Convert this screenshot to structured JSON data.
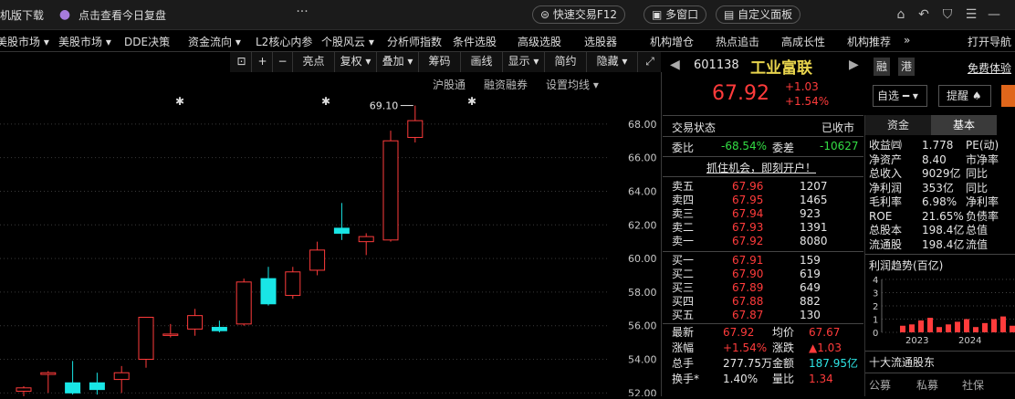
{
  "titlebar": {
    "download": "机版下载",
    "review": "点击查看今日复盘",
    "quick_trade": "快速交易F12",
    "multi_window": "多窗口",
    "custom_panel": "自定义面板"
  },
  "menu": [
    "美股市场 ▾",
    "美股市场 ▾",
    "DDE决策",
    "资金流向 ▾",
    "L2核心内参",
    "个股风云 ▾",
    "分析师指数",
    "条件选股",
    "高级选股",
    "选股器",
    "机构增仓",
    "热点追击",
    "高成长性",
    "机构推荐",
    "»",
    "打开导航"
  ],
  "chart_tools": [
    "亮点",
    "复权 ▾",
    "叠加 ▾",
    "筹码",
    "画线",
    "显示 ▾",
    "简约",
    "隐藏 ▾"
  ],
  "chart_sublinks": [
    "沪股通",
    "融资融券",
    "设置均线 ▾"
  ],
  "chart_data": {
    "type": "candlestick",
    "y_ticks": [
      "68.00",
      "66.00",
      "64.00",
      "62.00",
      "60.00",
      "58.00",
      "56.00",
      "54.00",
      "52.00"
    ],
    "ylim": [
      51.8,
      70.0
    ],
    "max_label": "69.10",
    "candles": [
      {
        "o": 52.1,
        "h": 52.4,
        "l": 51.8,
        "c": 52.3
      },
      {
        "o": 53.1,
        "h": 53.3,
        "l": 52.0,
        "c": 53.2
      },
      {
        "o": 52.6,
        "h": 53.9,
        "l": 51.9,
        "c": 52.0
      },
      {
        "o": 52.6,
        "h": 53.2,
        "l": 51.9,
        "c": 52.2
      },
      {
        "o": 52.8,
        "h": 53.6,
        "l": 52.0,
        "c": 53.2
      },
      {
        "o": 54.0,
        "h": 56.5,
        "l": 53.5,
        "c": 56.5
      },
      {
        "o": 55.5,
        "h": 56.1,
        "l": 55.3,
        "c": 55.5
      },
      {
        "o": 55.8,
        "h": 57.0,
        "l": 55.4,
        "c": 56.6
      },
      {
        "o": 55.9,
        "h": 56.3,
        "l": 55.6,
        "c": 55.7
      },
      {
        "o": 56.1,
        "h": 58.8,
        "l": 56.0,
        "c": 58.6
      },
      {
        "o": 58.8,
        "h": 59.5,
        "l": 57.2,
        "c": 57.3
      },
      {
        "o": 57.8,
        "h": 59.5,
        "l": 57.6,
        "c": 59.2
      },
      {
        "o": 59.3,
        "h": 61.0,
        "l": 59.0,
        "c": 60.5
      },
      {
        "o": 61.8,
        "h": 63.3,
        "l": 61.1,
        "c": 61.5
      },
      {
        "o": 61.0,
        "h": 61.5,
        "l": 60.2,
        "c": 61.3
      },
      {
        "o": 61.1,
        "h": 67.6,
        "l": 61.0,
        "c": 67.0
      },
      {
        "o": 67.2,
        "h": 69.1,
        "l": 66.9,
        "c": 68.2
      }
    ]
  },
  "stock": {
    "code": "601138",
    "name": "工业富联",
    "price": "67.92",
    "change": "+1.03",
    "change_pct": "+1.54%",
    "tag_rong": "融",
    "tag_gang": "港",
    "free_trial": "免费体验",
    "add_self": "自选",
    "remind": "提醒"
  },
  "status": {
    "label": "交易状态",
    "value": "已收市"
  },
  "weibi": {
    "label1": "委比",
    "v1": "-68.54%",
    "label2": "委差",
    "v2": "-10627"
  },
  "promo": "抓住机会，即刻开户！",
  "asks": [
    {
      "label": "卖五",
      "price": "67.96",
      "vol": "1207"
    },
    {
      "label": "卖四",
      "price": "67.95",
      "vol": "1465"
    },
    {
      "label": "卖三",
      "price": "67.94",
      "vol": "923"
    },
    {
      "label": "卖二",
      "price": "67.93",
      "vol": "1391"
    },
    {
      "label": "卖一",
      "price": "67.92",
      "vol": "8080"
    }
  ],
  "bids": [
    {
      "label": "买一",
      "price": "67.91",
      "vol": "159"
    },
    {
      "label": "买二",
      "price": "67.90",
      "vol": "619"
    },
    {
      "label": "买三",
      "price": "67.89",
      "vol": "649"
    },
    {
      "label": "买四",
      "price": "67.88",
      "vol": "882"
    },
    {
      "label": "买五",
      "price": "67.87",
      "vol": "130"
    }
  ],
  "stats": [
    {
      "l1": "最新",
      "v1": "67.92",
      "c1": "red",
      "l2": "均价",
      "v2": "67.67",
      "c2": "red"
    },
    {
      "l1": "涨幅",
      "v1": "+1.54%",
      "c1": "red",
      "l2": "涨跌",
      "v2": "▲1.03",
      "c2": "red"
    },
    {
      "l1": "总手",
      "v1": "277.75万",
      "c1": "white",
      "l2": "金额",
      "v2": "187.95亿",
      "c2": "cyan"
    },
    {
      "l1": "换手*",
      "v1": "1.40%",
      "c1": "white",
      "l2": "量比",
      "v2": "1.34",
      "c2": "red"
    }
  ],
  "fund_tabs": [
    "资金",
    "基本"
  ],
  "fundamentals": [
    {
      "l": "收益㈣",
      "v": "1.778",
      "l2": "PE(动)"
    },
    {
      "l": "净资产",
      "v": "8.40",
      "l2": "市净率"
    },
    {
      "l": "总收入",
      "v": "9029亿",
      "l2": "同比"
    },
    {
      "l": "净利润",
      "v": "353亿",
      "l2": "同比"
    },
    {
      "l": "毛利率",
      "v": "6.98%",
      "l2": "净利率"
    },
    {
      "l": "ROE",
      "v": "21.65%",
      "l2": "负债率"
    },
    {
      "l": "总股本",
      "v": "198.4亿",
      "l2": "总值"
    },
    {
      "l": "流通股",
      "v": "198.4亿",
      "l2": "流值"
    }
  ],
  "profit": {
    "title": "利润趋势(百亿)",
    "y_ticks": [
      "4",
      "3",
      "2",
      "1",
      "0"
    ],
    "x_labels": [
      "2023",
      "2024"
    ],
    "bars": [
      0.5,
      0.6,
      0.9,
      1.1,
      0.4,
      0.6,
      0.8,
      1.0,
      0.4,
      0.7,
      1.0,
      1.2,
      0.5
    ]
  },
  "holders_title": "十大流通股东",
  "holder_tabs": [
    "公募",
    "私募",
    "社保"
  ]
}
